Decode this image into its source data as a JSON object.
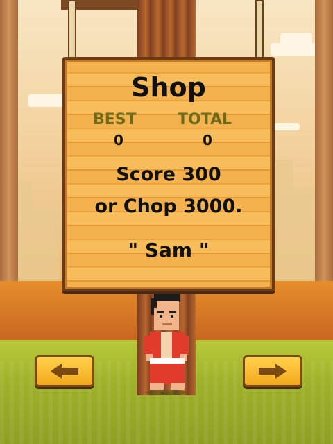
{
  "sign": {
    "title": "Shop",
    "best_label": "BEST",
    "best_value": "0",
    "total_label": "TOTAL",
    "total_value": "0",
    "unlock_line1": "Score 300",
    "unlock_line2": "or Chop 3000.",
    "character_name": "\" Sam \""
  },
  "buttons": {
    "left_icon": "arrow-left-icon",
    "right_icon": "arrow-right-icon"
  },
  "colors": {
    "sign_wood": "#f3b24e",
    "stat_label": "#6f6a1a",
    "button_yellow": "#ffd24a"
  }
}
